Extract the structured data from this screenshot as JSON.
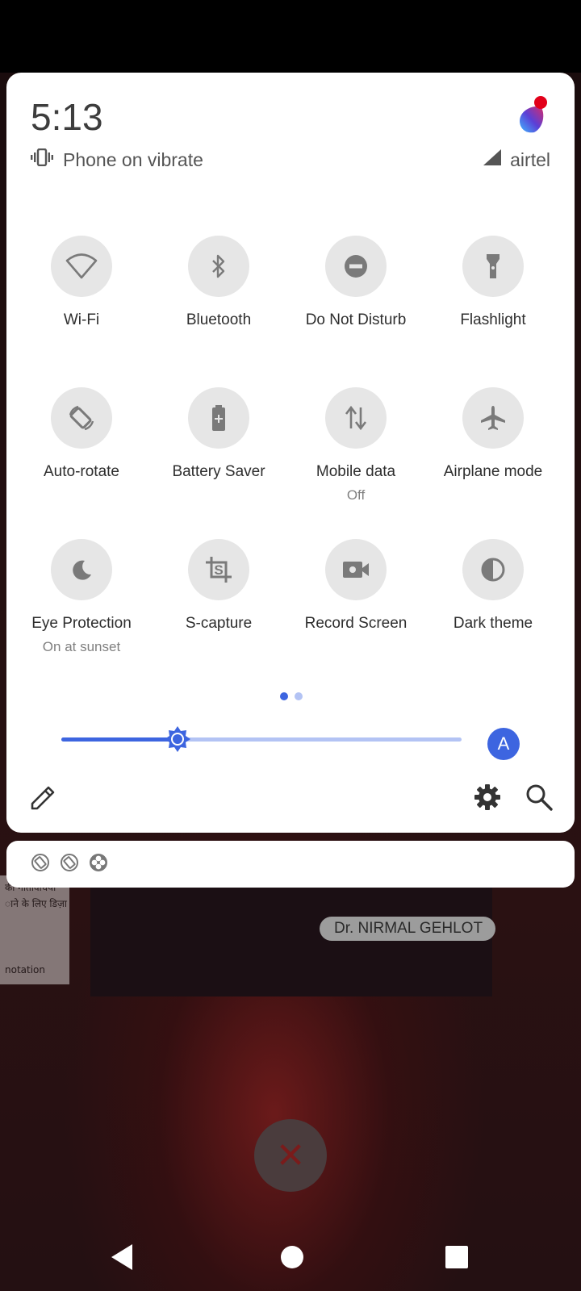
{
  "status": {
    "time": "5:13",
    "ringer": "Phone on vibrate",
    "carrier": "airtel"
  },
  "tiles": [
    {
      "id": "wifi",
      "label": "Wi-Fi",
      "sub": "",
      "icon": "wifi-icon"
    },
    {
      "id": "bluetooth",
      "label": "Bluetooth",
      "sub": "",
      "icon": "bluetooth-icon"
    },
    {
      "id": "dnd",
      "label": "Do Not Disturb",
      "sub": "",
      "icon": "do-not-disturb-icon"
    },
    {
      "id": "flashlight",
      "label": "Flashlight",
      "sub": "",
      "icon": "flashlight-icon"
    },
    {
      "id": "autorotate",
      "label": "Auto-rotate",
      "sub": "",
      "icon": "auto-rotate-icon"
    },
    {
      "id": "battery",
      "label": "Battery Saver",
      "sub": "",
      "icon": "battery-saver-icon"
    },
    {
      "id": "mobiledata",
      "label": "Mobile data",
      "sub": "Off",
      "icon": "mobile-data-icon"
    },
    {
      "id": "airplane",
      "label": "Airplane mode",
      "sub": "",
      "icon": "airplane-icon"
    },
    {
      "id": "eye",
      "label": "Eye Protection",
      "sub": "On at sunset",
      "icon": "moon-icon"
    },
    {
      "id": "scapture",
      "label": "S-capture",
      "sub": "",
      "icon": "s-capture-icon"
    },
    {
      "id": "record",
      "label": "Record Screen",
      "sub": "",
      "icon": "video-camera-icon"
    },
    {
      "id": "dark",
      "label": "Dark theme",
      "sub": "",
      "icon": "dark-theme-icon"
    }
  ],
  "pager": {
    "pages": 2,
    "current": 1
  },
  "brightness": {
    "level": 0.29,
    "auto_label": "A"
  },
  "colors": {
    "accent": "#3d65e0",
    "accent_light": "#b3c3f4",
    "tile_bg": "#e6e6e6",
    "icon_gray": "#7a7a7a"
  },
  "background": {
    "doc_lines": [
      "की गतिविधियों",
      "ाने के लिए डिज़ा",
      "notation"
    ],
    "video_name": "Dr. NIRMAL GEHLOT"
  },
  "notification_icons": [
    "screen-capture-icon",
    "screen-capture-icon",
    "fan-icon"
  ],
  "navbar": [
    "back-icon",
    "home-icon",
    "recents-icon"
  ]
}
